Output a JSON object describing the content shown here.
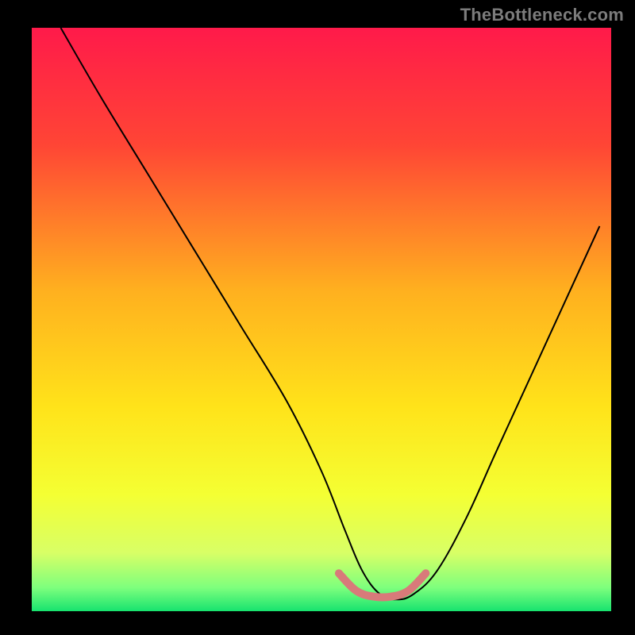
{
  "watermark": "TheBottleneck.com",
  "chart_data": {
    "type": "line",
    "title": "",
    "xlabel": "",
    "ylabel": "",
    "xlim": [
      0,
      100
    ],
    "ylim": [
      0,
      100
    ],
    "gradient_stops": [
      {
        "offset": 0,
        "color": "#ff1a4a"
      },
      {
        "offset": 20,
        "color": "#ff4535"
      },
      {
        "offset": 45,
        "color": "#ffb01f"
      },
      {
        "offset": 65,
        "color": "#ffe31a"
      },
      {
        "offset": 80,
        "color": "#f4ff33"
      },
      {
        "offset": 90,
        "color": "#d8ff66"
      },
      {
        "offset": 96,
        "color": "#7dff7d"
      },
      {
        "offset": 100,
        "color": "#17e36f"
      }
    ],
    "series": [
      {
        "name": "bottleneck-curve",
        "color": "#000000",
        "width": 2,
        "x": [
          5,
          12,
          20,
          28,
          36,
          44,
          50,
          54,
          57,
          60,
          63,
          66,
          70,
          75,
          80,
          86,
          92,
          98
        ],
        "y": [
          100,
          88,
          75,
          62,
          49,
          36,
          24,
          14,
          7,
          3,
          2,
          3,
          7,
          16,
          27,
          40,
          53,
          66
        ]
      }
    ],
    "flat_marker": {
      "name": "optimal-range",
      "color": "#d87a7a",
      "width": 10,
      "linecap": "round",
      "x": [
        53,
        56,
        59,
        62,
        65,
        68
      ],
      "y": [
        6.5,
        3.5,
        2.5,
        2.5,
        3.5,
        6.5
      ]
    }
  }
}
